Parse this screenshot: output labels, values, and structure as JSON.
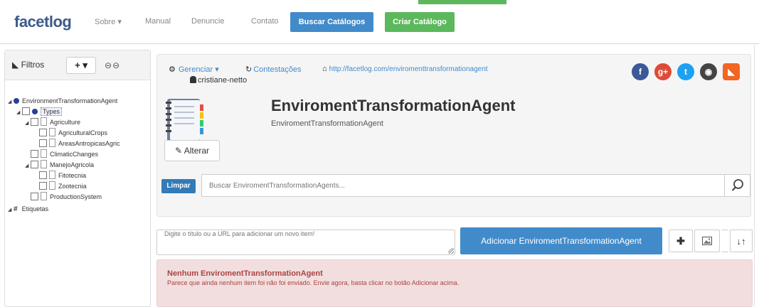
{
  "nav": {
    "brand": "facetlog",
    "items": [
      "Sobre ▾",
      "Manual",
      "Denuncie",
      "Contato"
    ],
    "buscar_label": "Buscar Catálogos",
    "criar_label": "Criar Catálogo"
  },
  "sidebar": {
    "filtros_label": "Filtros",
    "add_label": "+ ▾",
    "tree": [
      {
        "label": "EnvironmentTransformationAgent",
        "depth": 0,
        "expander": "◢",
        "checkbox": false,
        "marker": "dot"
      },
      {
        "label": "Types",
        "depth": 1,
        "expander": "◢",
        "checkbox": true,
        "marker": "dot",
        "selected": true
      },
      {
        "label": "Agriculture",
        "depth": 2,
        "expander": "◢",
        "checkbox": true,
        "marker": "doc"
      },
      {
        "label": "AgriculturalCrops",
        "depth": 3,
        "expander": "",
        "checkbox": true,
        "marker": "doc"
      },
      {
        "label": "AreasAntropicasAgric",
        "depth": 3,
        "expander": "",
        "checkbox": true,
        "marker": "doc"
      },
      {
        "label": "ClimaticChanges",
        "depth": 2,
        "expander": "",
        "checkbox": true,
        "marker": "doc"
      },
      {
        "label": "ManejoAgricola",
        "depth": 2,
        "expander": "◢",
        "checkbox": true,
        "marker": "doc"
      },
      {
        "label": "Fitotecnia",
        "depth": 3,
        "expander": "",
        "checkbox": true,
        "marker": "doc"
      },
      {
        "label": "Zootecnia",
        "depth": 3,
        "expander": "",
        "checkbox": true,
        "marker": "doc"
      },
      {
        "label": "ProductionSystem",
        "depth": 2,
        "expander": "",
        "checkbox": true,
        "marker": "doc"
      },
      {
        "label": "Etiquetas",
        "depth": 0,
        "expander": "◢",
        "checkbox": false,
        "marker": "hash"
      }
    ]
  },
  "catalog": {
    "gerenciar_label": "Gerenciar ▾",
    "contestacoes_label": "Contestações",
    "url": "http://facetlog.com/enviromenttransformationagent",
    "user": "cristiane-netto",
    "title": "EnviromentTransformationAgent",
    "subtitle": "EnviromentTransformationAgent",
    "alterar_label": "Alterar",
    "limpar_label": "Limpar",
    "search_placeholder": "Buscar EnviromentTransformationAgents...",
    "socials": [
      {
        "name": "facebook-icon",
        "glyph": "f",
        "color": "#3b5998"
      },
      {
        "name": "google-plus-icon",
        "glyph": "g+",
        "color": "#dd4b39"
      },
      {
        "name": "twitter-icon",
        "glyph": "t",
        "color": "#1da1f2"
      },
      {
        "name": "github-icon",
        "glyph": "◉",
        "color": "#444444"
      },
      {
        "name": "rss-icon",
        "glyph": "◣",
        "color": "#f26522"
      }
    ]
  },
  "add_item": {
    "placeholder": "Digite o título ou a URL para adicionar um novo item!",
    "button_label": "Adicionar EnviromentTransformationAgent"
  },
  "alert": {
    "title": "Nenhum EnviromentTransformationAgent",
    "text": "Parece que ainda nenhum item foi não foi enviado. Envie agora, basta clicar no botão Adicionar acima."
  },
  "colors": {
    "brand": "#3d5a8a",
    "primary": "#428bca",
    "success": "#5cb85c",
    "alert_bg": "#f2dede",
    "alert_text": "#a94442"
  }
}
